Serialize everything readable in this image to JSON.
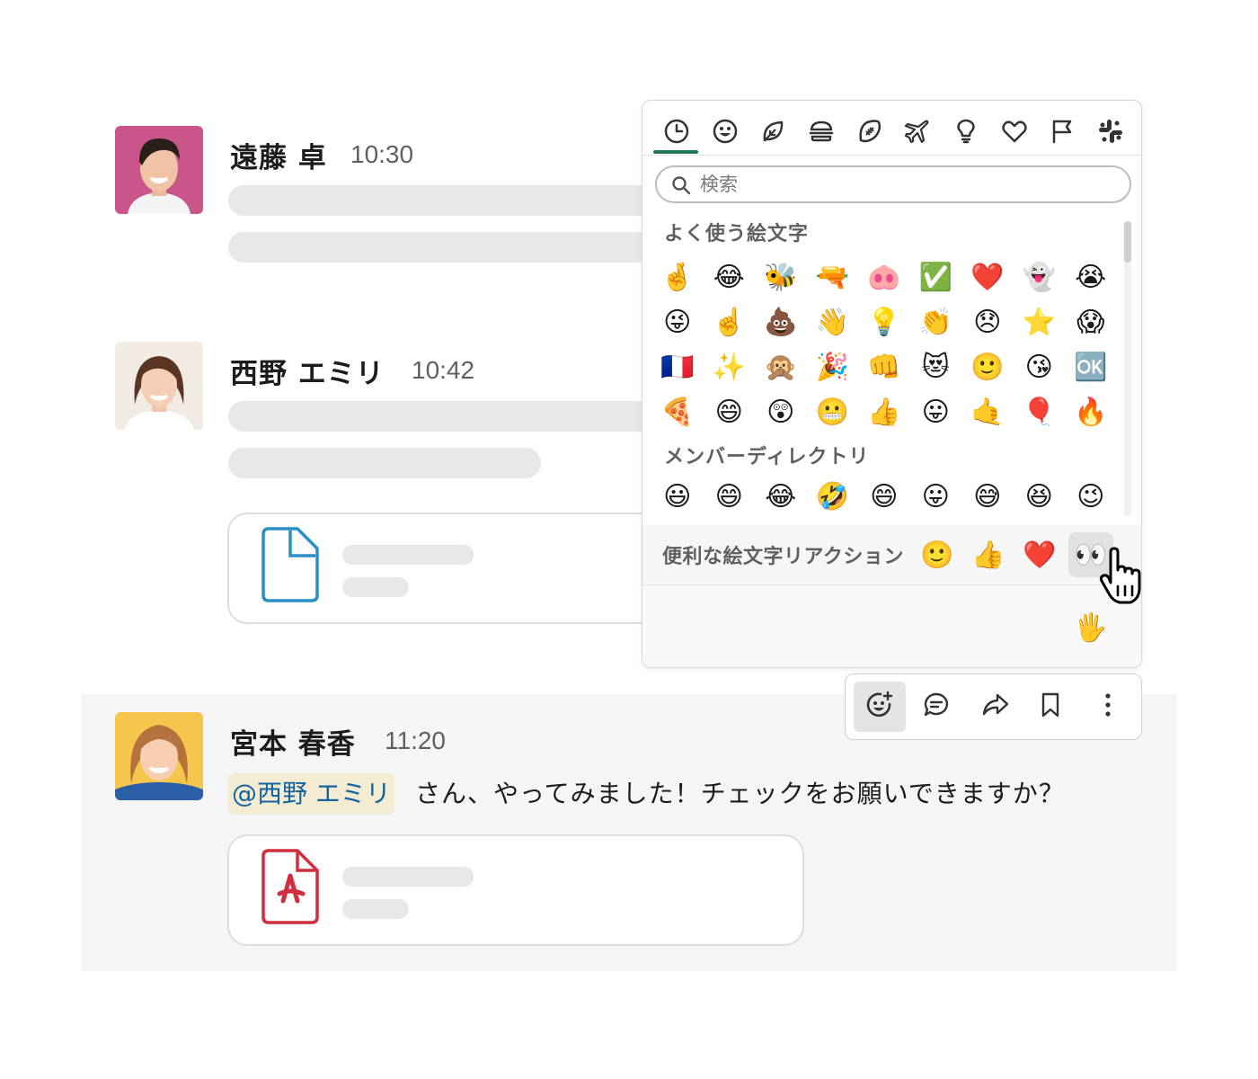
{
  "messages": [
    {
      "author": "遠藤 卓",
      "time": "10:30"
    },
    {
      "author": "西野 エミリ",
      "time": "10:42"
    },
    {
      "author": "宮本 春香",
      "time": "11:20",
      "mention": "@西野 エミリ",
      "text": "さん、やってみました！チェックをお願いできますか？"
    }
  ],
  "emoji_picker": {
    "categories": [
      "clock-icon",
      "smiley-icon",
      "leaf-icon",
      "burger-icon",
      "football-icon",
      "airplane-icon",
      "lightbulb-icon",
      "heart-icon",
      "flag-icon",
      "slack-icon"
    ],
    "active_category": "clock-icon",
    "search_placeholder": "検索",
    "frequent_label": "よく使う絵文字",
    "frequent": [
      "🤞",
      "😂",
      "🐝",
      "🔫",
      "🐽",
      "✅",
      "❤️",
      "👻",
      "😭",
      "😜",
      "☝️",
      "💩",
      "👋",
      "💡",
      "👏",
      "😞",
      "⭐",
      "😱",
      "🇫🇷",
      "✨",
      "🙊",
      "🎉",
      "👊",
      "😻",
      "🙂",
      "😘",
      "🆗",
      "🍕",
      "😄",
      "😲",
      "😬",
      "👍",
      "😛",
      "🤙",
      "🎈",
      "🔥"
    ],
    "member_label": "メンバーディレクトリ",
    "member": [
      "😃",
      "😄",
      "😂",
      "🤣",
      "😄",
      "😛",
      "😅",
      "😆",
      "😉"
    ],
    "quick_label": "便利な絵文字リアクション",
    "quick": [
      "🙂",
      "👍",
      "❤️",
      "👀"
    ],
    "skin_tone": "🖐️"
  },
  "toolbar": [
    "add-reaction-icon",
    "reply-thread-icon",
    "share-icon",
    "bookmark-icon",
    "more-actions-icon"
  ],
  "colors": {
    "accent_green": "#1d7a55",
    "mention_bg": "#f3ecd3",
    "mention_text": "#1264a3",
    "file_blue": "#2a8fc7",
    "pdf_red": "#d12e3e"
  }
}
